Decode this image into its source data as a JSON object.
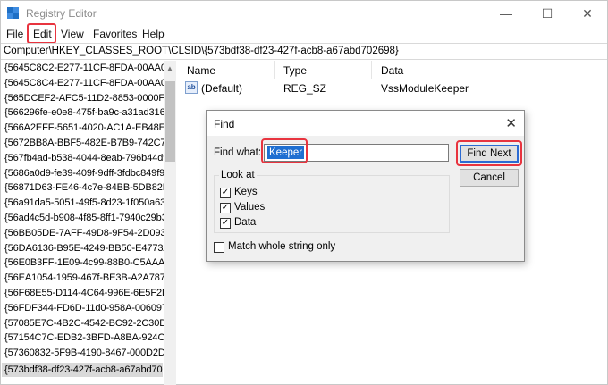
{
  "window": {
    "title": "Registry Editor",
    "controls": {
      "minimize": "—",
      "maximize": "☐",
      "close": "✕"
    }
  },
  "menu": [
    "File",
    "Edit",
    "View",
    "Favorites",
    "Help"
  ],
  "address": "Computer\\HKEY_CLASSES_ROOT\\CLSID\\{573bdf38-df23-427f-acb8-a67abd702698}",
  "tree": {
    "items": [
      "{5645C8C2-E277-11CF-8FDA-00AA00",
      "{5645C8C4-E277-11CF-8FDA-00AA00",
      "{565DCEF2-AFC5-11D2-8853-0000F80",
      "{566296fe-e0e8-475f-ba9c-a31ad3162",
      "{566A2EFF-5651-4020-AC1A-EB48E45",
      "{5672BB8A-BBF5-482E-B7B9-742C700",
      "{567fb4ad-b538-4044-8eab-796b44d9",
      "{5686a0d9-fe39-409f-9dff-3fdbc849f9",
      "{56871D63-FE46-4c7e-84BB-5DB82D4",
      "{56a91da5-5051-49f5-8d23-1f050a63e",
      "{56ad4c5d-b908-4f85-8ff1-7940c29b3",
      "{56BB05DE-7AFF-49D8-9F54-2D0936E",
      "{56DA6136-B95E-4249-BB50-E4773A2",
      "{56E0B3FF-1E09-4c99-88B0-C5AAA2",
      "{56EA1054-1959-467f-BE3B-A2A787C",
      "{56F68E55-D114-4C64-996E-6E5F2D5",
      "{56FDF344-FD6D-11d0-958A-006097C",
      "{57085E7C-4B2C-4542-BC92-2C30D1",
      "{57154C7C-EDB2-3BFD-A8BA-924C60",
      "{57360832-5F9B-4190-8467-000D2D5",
      "{573bdf38-df23-427f-acb8-a67abd70"
    ],
    "selected_index": 20
  },
  "list": {
    "headers": [
      "Name",
      "Type",
      "Data"
    ],
    "rows": [
      {
        "icon": "ab",
        "name": "(Default)",
        "type": "REG_SZ",
        "data": "VssModuleKeeper"
      }
    ]
  },
  "find_dialog": {
    "title": "Find",
    "find_what_label": "Find what:",
    "find_what_value": "Keeper",
    "find_next_label": "Find Next",
    "cancel_label": "Cancel",
    "look_at_label": "Look at",
    "options": [
      {
        "label": "Keys",
        "checked": true
      },
      {
        "label": "Values",
        "checked": true
      },
      {
        "label": "Data",
        "checked": true
      }
    ],
    "match_whole_label": "Match whole string only",
    "match_whole_checked": false
  },
  "colors": {
    "highlight": "#e8343f",
    "selection": "#1f6fd1",
    "accent": "#2b6bd3"
  }
}
